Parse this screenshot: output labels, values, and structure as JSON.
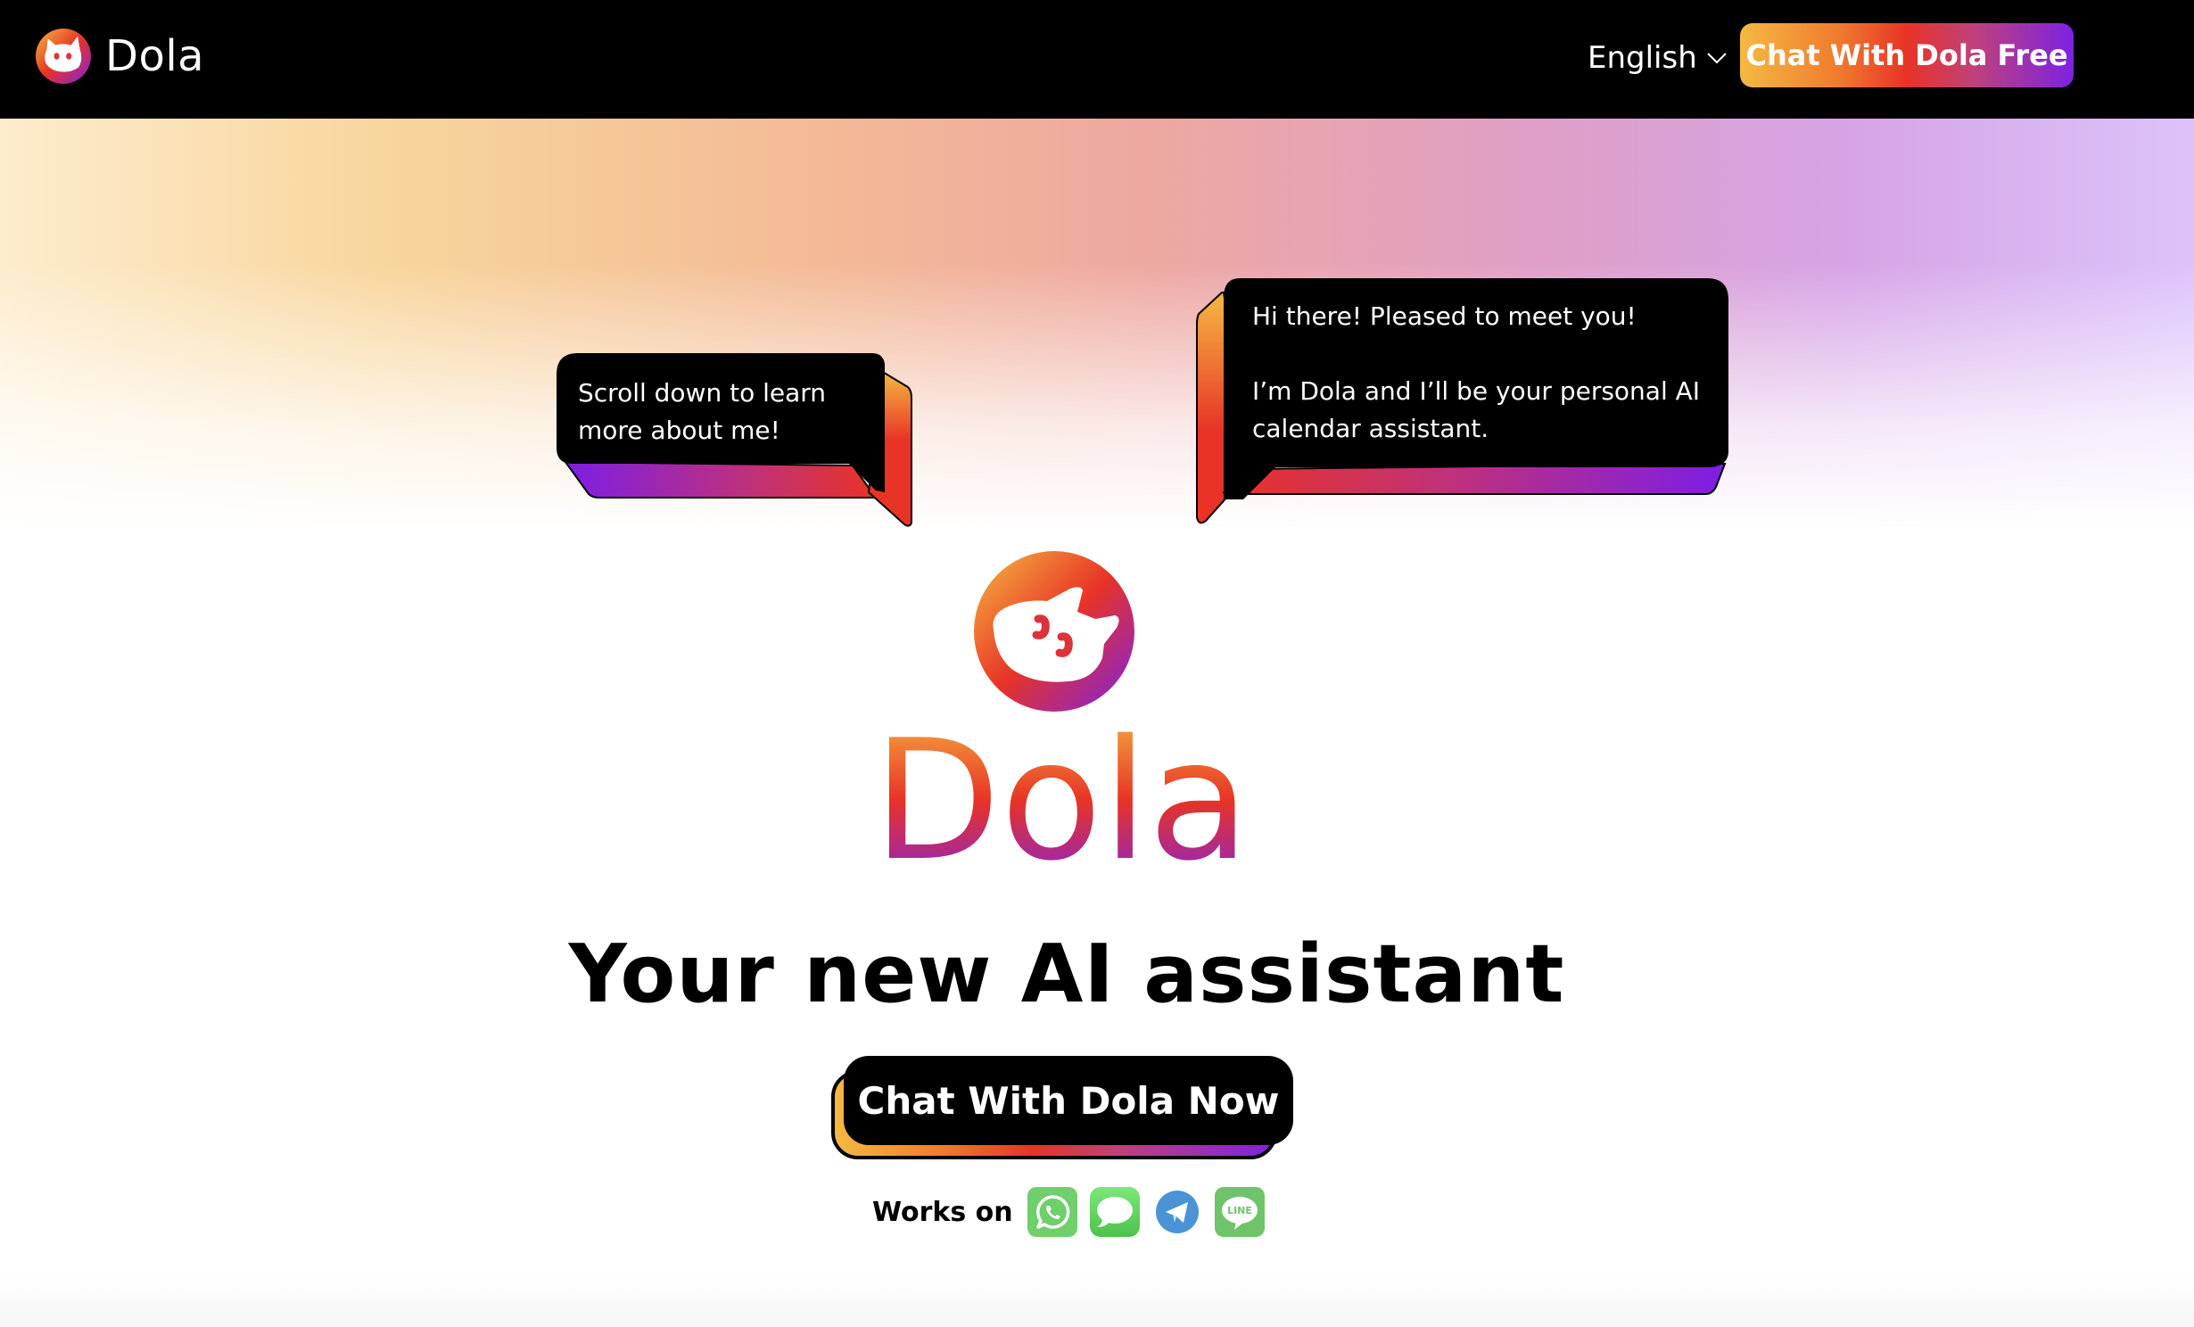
{
  "header": {
    "brand_name": "Dola",
    "language": {
      "selected": "English",
      "icon": "chevron-down-icon"
    },
    "cta_label": "Chat With Dola Free"
  },
  "hero": {
    "bubble_left": {
      "text": "Scroll down to learn\nmore about me!"
    },
    "bubble_right": {
      "text": "Hi there! Pleased to meet you!\n\nI’m Dola and I’ll be your personal AI\ncalendar assistant."
    },
    "wordmark": "Dola",
    "tagline": "Your new AI assistant",
    "cta_label": "Chat With Dola Now",
    "works_on": {
      "label": "Works on",
      "platforms": [
        {
          "name": "WhatsApp",
          "icon": "whatsapp-icon",
          "color": "#6fcf6b"
        },
        {
          "name": "Messages",
          "icon": "messages-icon",
          "color": "#5bd45b"
        },
        {
          "name": "Telegram",
          "icon": "telegram-icon",
          "color": "#4a94d6"
        },
        {
          "name": "LINE",
          "icon": "line-icon",
          "color": "#6fc36b",
          "badge_text": "LINE"
        }
      ]
    }
  },
  "colors": {
    "brand_gradient": [
      "#f5b942",
      "#e83326",
      "#7d22e3"
    ],
    "header_bg": "#000000"
  }
}
